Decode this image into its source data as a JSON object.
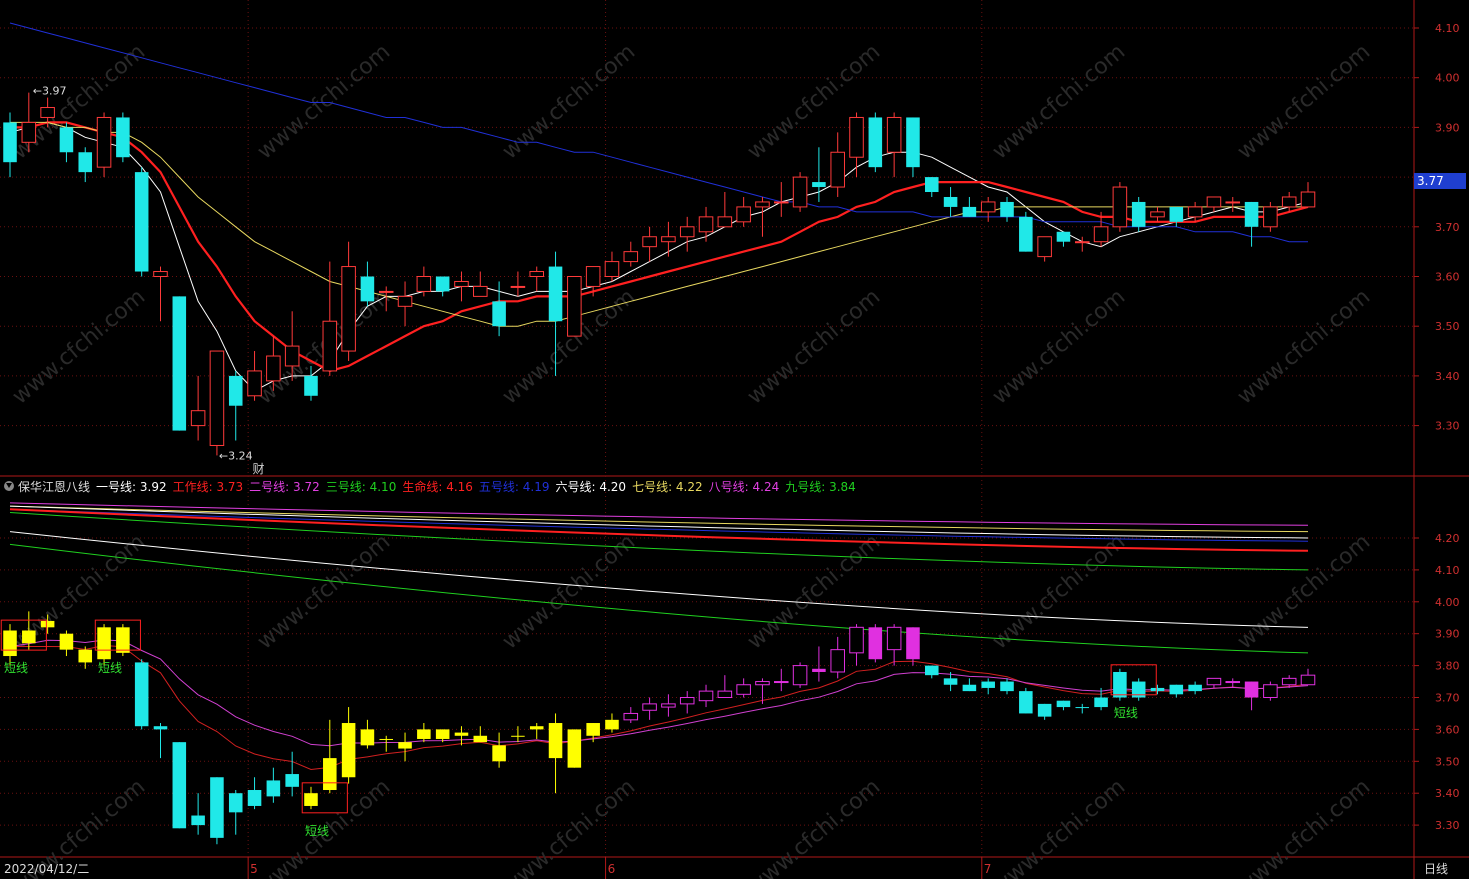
{
  "chart_data": [
    {
      "type": "candlestick",
      "panel": "main",
      "y_ticks": [
        "4.10",
        "4.00",
        "3.90",
        "3.80",
        "3.70",
        "3.60",
        "3.50",
        "3.40",
        "3.30"
      ],
      "ylim": [
        3.2,
        4.2
      ],
      "annotations": {
        "high": "3.97",
        "low": "3.24",
        "event": "财"
      },
      "last_price": "3.77",
      "candles": [
        [
          3.91,
          3.83,
          3.93,
          3.8
        ],
        [
          3.87,
          3.91,
          3.97,
          3.85
        ],
        [
          3.92,
          3.94,
          3.96,
          3.9
        ],
        [
          3.9,
          3.85,
          3.91,
          3.83
        ],
        [
          3.85,
          3.81,
          3.86,
          3.79
        ],
        [
          3.82,
          3.92,
          3.93,
          3.8
        ],
        [
          3.92,
          3.84,
          3.93,
          3.83
        ],
        [
          3.81,
          3.61,
          3.82,
          3.6
        ],
        [
          3.6,
          3.61,
          3.62,
          3.51
        ],
        [
          3.56,
          3.29,
          3.56,
          3.29
        ],
        [
          3.3,
          3.33,
          3.4,
          3.27
        ],
        [
          3.26,
          3.45,
          3.45,
          3.24
        ],
        [
          3.4,
          3.34,
          3.41,
          3.27
        ],
        [
          3.36,
          3.41,
          3.45,
          3.35
        ],
        [
          3.39,
          3.44,
          3.48,
          3.37
        ],
        [
          3.42,
          3.46,
          3.53,
          3.39
        ],
        [
          3.4,
          3.36,
          3.42,
          3.35
        ],
        [
          3.41,
          3.51,
          3.63,
          3.4
        ],
        [
          3.45,
          3.62,
          3.67,
          3.43
        ],
        [
          3.6,
          3.55,
          3.63,
          3.54
        ],
        [
          3.57,
          3.57,
          3.58,
          3.53
        ],
        [
          3.54,
          3.56,
          3.59,
          3.5
        ],
        [
          3.57,
          3.6,
          3.62,
          3.56
        ],
        [
          3.6,
          3.57,
          3.6,
          3.56
        ],
        [
          3.58,
          3.59,
          3.61,
          3.55
        ],
        [
          3.56,
          3.58,
          3.61,
          3.56
        ],
        [
          3.55,
          3.5,
          3.59,
          3.48
        ],
        [
          3.58,
          3.58,
          3.61,
          3.56
        ],
        [
          3.6,
          3.61,
          3.62,
          3.57
        ],
        [
          3.62,
          3.51,
          3.65,
          3.4
        ],
        [
          3.48,
          3.6,
          3.6,
          3.48
        ],
        [
          3.58,
          3.62,
          3.62,
          3.56
        ],
        [
          3.6,
          3.63,
          3.65,
          3.59
        ],
        [
          3.63,
          3.65,
          3.67,
          3.62
        ],
        [
          3.66,
          3.68,
          3.7,
          3.63
        ],
        [
          3.67,
          3.68,
          3.71,
          3.64
        ],
        [
          3.68,
          3.7,
          3.72,
          3.65
        ],
        [
          3.69,
          3.72,
          3.74,
          3.67
        ],
        [
          3.7,
          3.72,
          3.77,
          3.7
        ],
        [
          3.71,
          3.74,
          3.76,
          3.7
        ],
        [
          3.74,
          3.75,
          3.76,
          3.68
        ],
        [
          3.75,
          3.75,
          3.79,
          3.72
        ],
        [
          3.74,
          3.8,
          3.81,
          3.73
        ],
        [
          3.79,
          3.78,
          3.86,
          3.75
        ],
        [
          3.78,
          3.85,
          3.89,
          3.76
        ],
        [
          3.84,
          3.92,
          3.93,
          3.8
        ],
        [
          3.92,
          3.82,
          3.93,
          3.81
        ],
        [
          3.85,
          3.92,
          3.93,
          3.8
        ],
        [
          3.92,
          3.82,
          3.92,
          3.8
        ],
        [
          3.8,
          3.77,
          3.8,
          3.76
        ],
        [
          3.76,
          3.74,
          3.78,
          3.72
        ],
        [
          3.74,
          3.72,
          3.76,
          3.72
        ],
        [
          3.73,
          3.75,
          3.76,
          3.71
        ],
        [
          3.75,
          3.72,
          3.76,
          3.71
        ],
        [
          3.72,
          3.65,
          3.73,
          3.65
        ],
        [
          3.64,
          3.68,
          3.68,
          3.63
        ],
        [
          3.69,
          3.67,
          3.69,
          3.66
        ],
        [
          3.67,
          3.67,
          3.68,
          3.65
        ],
        [
          3.67,
          3.7,
          3.73,
          3.66
        ],
        [
          3.7,
          3.78,
          3.79,
          3.69
        ],
        [
          3.75,
          3.7,
          3.76,
          3.69
        ],
        [
          3.72,
          3.73,
          3.74,
          3.71
        ],
        [
          3.74,
          3.71,
          3.74,
          3.7
        ],
        [
          3.72,
          3.74,
          3.75,
          3.71
        ],
        [
          3.74,
          3.76,
          3.76,
          3.73
        ],
        [
          3.75,
          3.75,
          3.76,
          3.73
        ],
        [
          3.75,
          3.7,
          3.75,
          3.66
        ],
        [
          3.7,
          3.74,
          3.75,
          3.69
        ],
        [
          3.74,
          3.76,
          3.77,
          3.73
        ],
        [
          3.74,
          3.77,
          3.79,
          3.74
        ]
      ],
      "series": [
        {
          "color": "#ffffff",
          "values": [
            3.89,
            3.9,
            3.91,
            3.9,
            3.88,
            3.87,
            3.86,
            3.82,
            3.77,
            3.66,
            3.55,
            3.49,
            3.41,
            3.37,
            3.39,
            3.4,
            3.4,
            3.43,
            3.49,
            3.54,
            3.56,
            3.56,
            3.57,
            3.57,
            3.58,
            3.58,
            3.57,
            3.56,
            3.57,
            3.57,
            3.57,
            3.58,
            3.59,
            3.61,
            3.63,
            3.65,
            3.67,
            3.68,
            3.7,
            3.72,
            3.73,
            3.75,
            3.76,
            3.77,
            3.79,
            3.82,
            3.84,
            3.85,
            3.85,
            3.84,
            3.82,
            3.8,
            3.78,
            3.77,
            3.74,
            3.71,
            3.69,
            3.67,
            3.66,
            3.68,
            3.69,
            3.7,
            3.71,
            3.72,
            3.73,
            3.74,
            3.73,
            3.73,
            3.74,
            3.75
          ]
        },
        {
          "color": "#ff2020",
          "values": [
            3.9,
            3.9,
            3.91,
            3.91,
            3.9,
            3.89,
            3.88,
            3.85,
            3.81,
            3.74,
            3.67,
            3.62,
            3.56,
            3.51,
            3.48,
            3.45,
            3.43,
            3.41,
            3.42,
            3.44,
            3.46,
            3.48,
            3.5,
            3.51,
            3.53,
            3.54,
            3.55,
            3.55,
            3.56,
            3.56,
            3.56,
            3.57,
            3.58,
            3.59,
            3.6,
            3.61,
            3.62,
            3.63,
            3.64,
            3.65,
            3.66,
            3.67,
            3.69,
            3.71,
            3.72,
            3.74,
            3.75,
            3.77,
            3.78,
            3.79,
            3.79,
            3.79,
            3.79,
            3.78,
            3.77,
            3.76,
            3.75,
            3.73,
            3.72,
            3.72,
            3.71,
            3.71,
            3.71,
            3.71,
            3.72,
            3.72,
            3.72,
            3.72,
            3.73,
            3.74
          ]
        },
        {
          "color": "#e8d860",
          "values": [
            3.91,
            3.91,
            3.91,
            3.9,
            3.9,
            3.89,
            3.89,
            3.87,
            3.84,
            3.8,
            3.76,
            3.73,
            3.7,
            3.67,
            3.65,
            3.63,
            3.61,
            3.59,
            3.58,
            3.57,
            3.56,
            3.55,
            3.54,
            3.53,
            3.52,
            3.51,
            3.5,
            3.5,
            3.51,
            3.51,
            3.52,
            3.53,
            3.54,
            3.55,
            3.56,
            3.57,
            3.58,
            3.59,
            3.6,
            3.61,
            3.62,
            3.63,
            3.64,
            3.65,
            3.66,
            3.67,
            3.68,
            3.69,
            3.7,
            3.71,
            3.72,
            3.73,
            3.73,
            3.74,
            3.74,
            3.74,
            3.74,
            3.74,
            3.74,
            3.74,
            3.74,
            3.74,
            3.74,
            3.74,
            3.74,
            3.74,
            3.74,
            3.74,
            3.74,
            3.74
          ]
        },
        {
          "color": "#2030d8",
          "values": [
            4.11,
            4.1,
            4.09,
            4.08,
            4.07,
            4.06,
            4.05,
            4.04,
            4.03,
            4.02,
            4.01,
            4.0,
            3.99,
            3.98,
            3.97,
            3.96,
            3.95,
            3.95,
            3.94,
            3.93,
            3.92,
            3.92,
            3.91,
            3.9,
            3.9,
            3.89,
            3.88,
            3.87,
            3.87,
            3.86,
            3.85,
            3.85,
            3.84,
            3.83,
            3.82,
            3.81,
            3.8,
            3.79,
            3.78,
            3.77,
            3.76,
            3.75,
            3.75,
            3.74,
            3.74,
            3.73,
            3.73,
            3.73,
            3.73,
            3.72,
            3.72,
            3.72,
            3.72,
            3.72,
            3.72,
            3.71,
            3.71,
            3.71,
            3.71,
            3.7,
            3.7,
            3.7,
            3.7,
            3.69,
            3.69,
            3.69,
            3.68,
            3.68,
            3.67,
            3.67
          ]
        }
      ]
    },
    {
      "type": "line",
      "panel": "indicator",
      "title": "保华江恩八线",
      "y_ticks": [
        "4.20",
        "4.10",
        "4.00",
        "3.90",
        "3.80",
        "3.70",
        "3.60",
        "3.50",
        "3.40",
        "3.30"
      ],
      "ylim": [
        3.22,
        4.31
      ],
      "legend": [
        {
          "label": "一号线: ",
          "value": "3.92",
          "color": "#ffffff"
        },
        {
          "label": "工作线: ",
          "value": "3.73",
          "color": "#ff2020"
        },
        {
          "label": "二号线: ",
          "value": "3.72",
          "color": "#e040e0"
        },
        {
          "label": "三号线: ",
          "value": "4.10",
          "color": "#20d020"
        },
        {
          "label": "生命线: ",
          "value": "4.16",
          "color": "#ff2020"
        },
        {
          "label": "五号线: ",
          "value": "4.19",
          "color": "#2030d8"
        },
        {
          "label": "六号线: ",
          "value": "4.20",
          "color": "#ffffff"
        },
        {
          "label": "七号线: ",
          "value": "4.22",
          "color": "#e8d860"
        },
        {
          "label": "八号线: ",
          "value": "4.24",
          "color": "#e040e0"
        },
        {
          "label": "九号线: ",
          "value": "3.84",
          "color": "#20d020"
        }
      ],
      "signals": [
        {
          "label": "短线",
          "index": 0
        },
        {
          "label": "短线",
          "index": 5
        },
        {
          "label": "短线",
          "index": 16
        },
        {
          "label": "短线",
          "index": 59
        }
      ],
      "lines": [
        {
          "color": "#e040e0",
          "start": 4.31,
          "end": 4.24
        },
        {
          "color": "#e8d860",
          "start": 4.3,
          "end": 4.22
        },
        {
          "color": "#ffffff",
          "start": 4.3,
          "end": 4.2
        },
        {
          "color": "#2030d8",
          "start": 4.29,
          "end": 4.19
        },
        {
          "color": "#ff2020",
          "start": 4.29,
          "end": 4.16
        },
        {
          "color": "#20d020",
          "start": 4.28,
          "end": 4.1
        },
        {
          "color": "#ffffff",
          "start": 4.22,
          "end": 3.92
        },
        {
          "color": "#20d020",
          "start": 4.18,
          "end": 3.84
        }
      ]
    }
  ],
  "x_axis": {
    "date_label": "2022/04/12/二",
    "month_ticks": [
      "5",
      "6",
      "7"
    ],
    "period_button": "日线"
  },
  "watermark": "www.cfchi.com"
}
